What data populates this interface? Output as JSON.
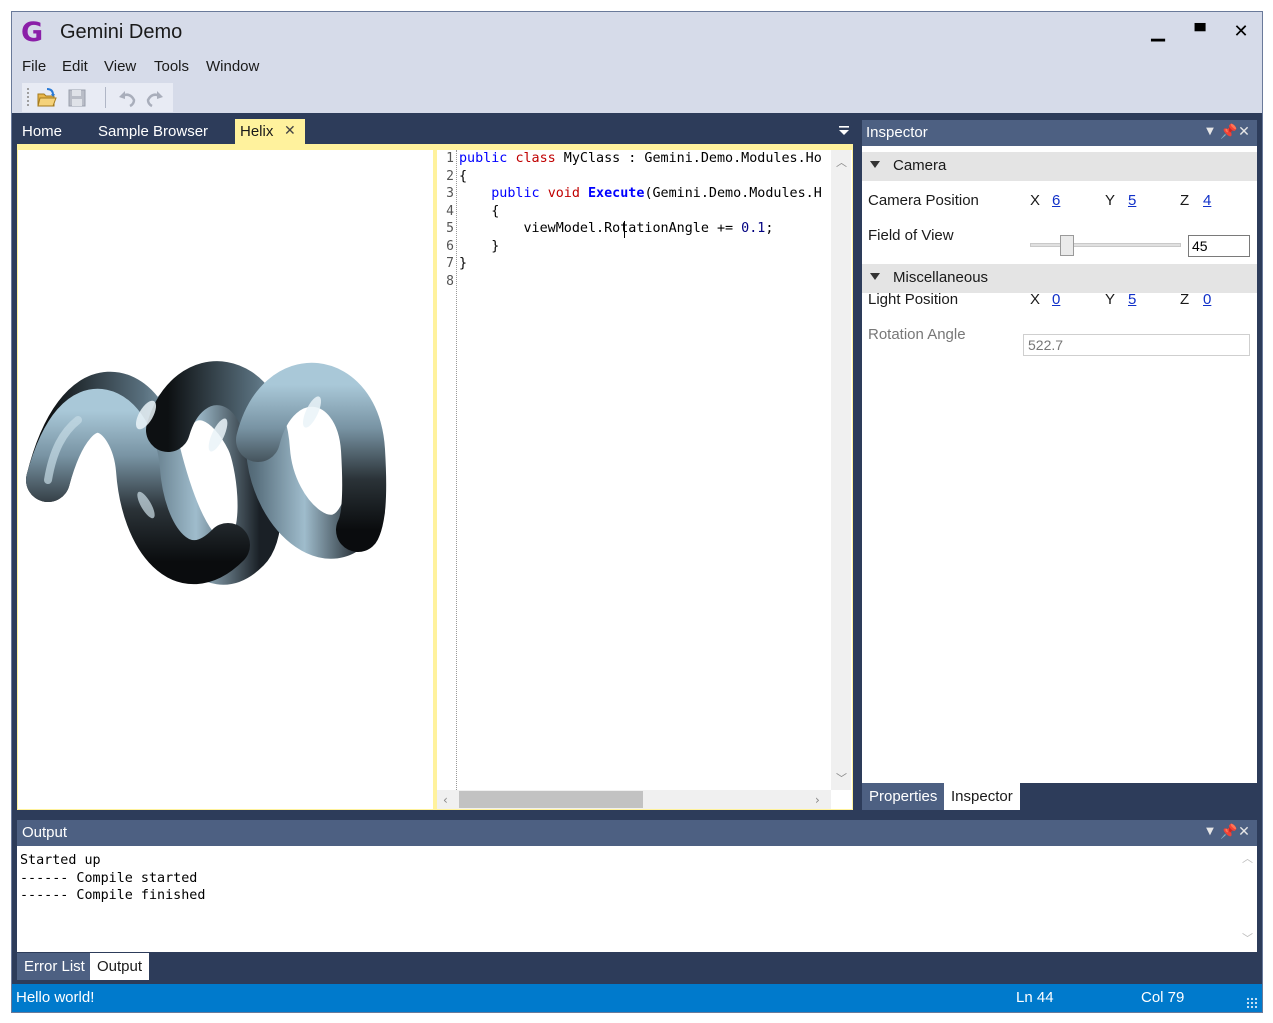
{
  "window": {
    "title": "Gemini Demo",
    "logo": "G",
    "minimize": "▁",
    "maximize": "▀",
    "close": "✕"
  },
  "menu": [
    "File",
    "Edit",
    "View",
    "Tools",
    "Window"
  ],
  "toolbar": {
    "icons": [
      "open-icon",
      "save-icon",
      "undo-icon",
      "redo-icon"
    ]
  },
  "document_tabs": [
    {
      "label": "Home",
      "active": false
    },
    {
      "label": "Sample Browser",
      "active": false
    },
    {
      "label": "Helix",
      "active": true,
      "close": "✕"
    }
  ],
  "editor": {
    "line_numbers": [
      "1",
      "2",
      "3",
      "4",
      "5",
      "6",
      "7",
      "8"
    ],
    "lines": [
      [
        {
          "t": "public",
          "c": "kw"
        },
        {
          "t": " "
        },
        {
          "t": "class",
          "c": "cls"
        },
        {
          "t": " MyClass : Gemini.Demo.Modules.Ho"
        }
      ],
      [
        {
          "t": "{"
        }
      ],
      [
        {
          "t": "    "
        },
        {
          "t": "public",
          "c": "kw"
        },
        {
          "t": " "
        },
        {
          "t": "void",
          "c": "cls"
        },
        {
          "t": " "
        },
        {
          "t": "Execute",
          "c": "kwb"
        },
        {
          "t": "(Gemini.Demo.Modules.H"
        }
      ],
      [
        {
          "t": "    {"
        }
      ],
      [
        {
          "t": "        viewModel.RotationAngle += "
        },
        {
          "t": "0.1",
          "c": "num"
        },
        {
          "t": ";"
        }
      ],
      [
        {
          "t": "    }"
        }
      ],
      [
        {
          "t": "}"
        }
      ],
      [
        {
          "t": ""
        }
      ]
    ]
  },
  "inspector": {
    "title": "Inspector",
    "sections": {
      "camera": "Camera",
      "misc": "Miscellaneous"
    },
    "camera_position": {
      "label": "Camera Position",
      "x_label": "X",
      "x": "6",
      "y_label": "Y",
      "y": "5",
      "z_label": "Z",
      "z": "4"
    },
    "field_of_view": {
      "label": "Field of View",
      "value": "45",
      "slider_fraction": 0.25
    },
    "light_position": {
      "label": "Light Position",
      "x_label": "X",
      "x": "0",
      "y_label": "Y",
      "y": "5",
      "z_label": "Z",
      "z": "0"
    },
    "rotation_angle": {
      "label": "Rotation Angle",
      "value": "522.7"
    },
    "tabs": [
      {
        "label": "Properties",
        "active": false
      },
      {
        "label": "Inspector",
        "active": true
      }
    ]
  },
  "output": {
    "title": "Output",
    "text": "Started up\n------ Compile started\n------ Compile finished",
    "tabs": [
      {
        "label": "Error List",
        "active": false
      },
      {
        "label": "Output",
        "active": true
      }
    ]
  },
  "status": {
    "message": "Hello world!",
    "line": "Ln 44",
    "column": "Col 79"
  },
  "colors": {
    "accent": "#007acc",
    "pane_header": "#4d6082",
    "active_doc_tab": "#fff29d",
    "frame": "#2d3c5a"
  }
}
